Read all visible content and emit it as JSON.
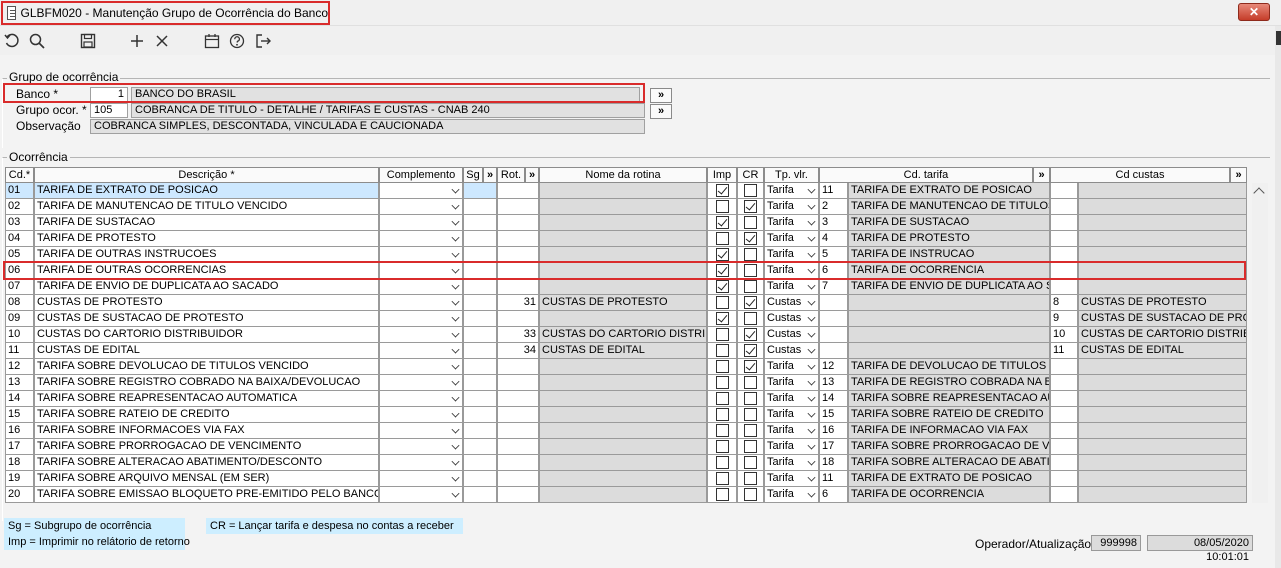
{
  "window": {
    "title": "GLBFM020 - Manutenção Grupo de Ocorrência do Banco",
    "close_label": "✕"
  },
  "group": {
    "title": "Grupo de ocorrência",
    "banco_label": "Banco *",
    "banco_code": "1",
    "banco_name": "BANCO DO BRASIL",
    "grupo_label": "Grupo ocor. *",
    "grupo_code": "105",
    "grupo_desc": "COBRANCA DE TITULO - DETALHE / TARIFAS E CUSTAS - CNAB 240",
    "obs_label": "Observação",
    "obs_value": "COBRANCA SIMPLES, DESCONTADA, VINCULADA E CAUCIONADA",
    "zoom_label": "»"
  },
  "ocorrencia": {
    "title": "Ocorrência",
    "headers": {
      "cd": "Cd.*",
      "descricao": "Descrição *",
      "complemento": "Complemento",
      "sg": "Sg",
      "zoom": "»",
      "rot": "Rot.",
      "nome_rotina": "Nome da rotina",
      "imp": "Imp",
      "cr": "CR",
      "tp_vlr": "Tp. vlr.",
      "cd_tarifa": "Cd. tarifa",
      "cd_custas": "Cd custas"
    },
    "rows": [
      {
        "cd": "01",
        "desc": "TARIFA DE EXTRATO DE POSICAO",
        "rot": "",
        "rot_name": "",
        "imp": true,
        "cr": false,
        "tp": "Tarifa",
        "tcode": "11",
        "tname": "TARIFA DE EXTRATO DE POSICAO",
        "ccode": "",
        "cname": ""
      },
      {
        "cd": "02",
        "desc": "TARIFA DE MANUTENCAO DE TITULO VENCIDO",
        "rot": "",
        "rot_name": "",
        "imp": false,
        "cr": true,
        "tp": "Tarifa",
        "tcode": "2",
        "tname": "TARIFA DE MANUTENCAO DE TITULOS VI",
        "ccode": "",
        "cname": ""
      },
      {
        "cd": "03",
        "desc": "TARIFA DE SUSTACAO",
        "rot": "",
        "rot_name": "",
        "imp": true,
        "cr": false,
        "tp": "Tarifa",
        "tcode": "3",
        "tname": "TARIFA DE SUSTACAO",
        "ccode": "",
        "cname": ""
      },
      {
        "cd": "04",
        "desc": "TARIFA DE PROTESTO",
        "rot": "",
        "rot_name": "",
        "imp": false,
        "cr": true,
        "tp": "Tarifa",
        "tcode": "4",
        "tname": "TARIFA DE PROTESTO",
        "ccode": "",
        "cname": ""
      },
      {
        "cd": "05",
        "desc": "TARIFA DE OUTRAS INSTRUCOES",
        "rot": "",
        "rot_name": "",
        "imp": true,
        "cr": false,
        "tp": "Tarifa",
        "tcode": "5",
        "tname": "TARIFA DE INSTRUCAO",
        "ccode": "",
        "cname": ""
      },
      {
        "cd": "06",
        "desc": "TARIFA DE OUTRAS OCORRENCIAS",
        "rot": "",
        "rot_name": "",
        "imp": true,
        "cr": false,
        "tp": "Tarifa",
        "tcode": "6",
        "tname": "TARIFA DE OCORRENCIA",
        "ccode": "",
        "cname": ""
      },
      {
        "cd": "07",
        "desc": "TARIFA DE ENVIO DE DUPLICATA AO SACADO",
        "rot": "",
        "rot_name": "",
        "imp": true,
        "cr": false,
        "tp": "Tarifa",
        "tcode": "7",
        "tname": "TARIFA DE ENVIO DE DUPLICATA AO SACAD",
        "ccode": "",
        "cname": ""
      },
      {
        "cd": "08",
        "desc": "CUSTAS DE PROTESTO",
        "rot": "31",
        "rot_name": "CUSTAS DE PROTESTO",
        "imp": false,
        "cr": true,
        "tp": "Custas",
        "tcode": "",
        "tname": "",
        "ccode": "8",
        "cname": "CUSTAS DE PROTESTO"
      },
      {
        "cd": "09",
        "desc": "CUSTAS DE SUSTACAO DE PROTESTO",
        "rot": "",
        "rot_name": "",
        "imp": true,
        "cr": false,
        "tp": "Custas",
        "tcode": "",
        "tname": "",
        "ccode": "9",
        "cname": "CUSTAS DE SUSTACAO DE PROT"
      },
      {
        "cd": "10",
        "desc": "CUSTAS DO CARTORIO DISTRIBUIDOR",
        "rot": "33",
        "rot_name": "CUSTAS DO CARTORIO DISTRIBU",
        "imp": false,
        "cr": true,
        "tp": "Custas",
        "tcode": "",
        "tname": "",
        "ccode": "10",
        "cname": "CUSTAS DE CARTORIO DISTRIBUI"
      },
      {
        "cd": "11",
        "desc": "CUSTAS DE EDITAL",
        "rot": "34",
        "rot_name": "CUSTAS DE EDITAL",
        "imp": false,
        "cr": true,
        "tp": "Custas",
        "tcode": "",
        "tname": "",
        "ccode": "11",
        "cname": "CUSTAS DE EDITAL"
      },
      {
        "cd": "12",
        "desc": "TARIFA SOBRE DEVOLUCAO DE TITULOS VENCIDO",
        "rot": "",
        "rot_name": "",
        "imp": false,
        "cr": true,
        "tp": "Tarifa",
        "tcode": "12",
        "tname": "TARIFA DE DEVOLUCAO DE TITULOS VEN",
        "ccode": "",
        "cname": ""
      },
      {
        "cd": "13",
        "desc": "TARIFA SOBRE REGISTRO COBRADO NA BAIXA/DEVOLUCAO",
        "rot": "",
        "rot_name": "",
        "imp": false,
        "cr": false,
        "tp": "Tarifa",
        "tcode": "13",
        "tname": "TARIFA DE REGISTRO COBRADA NA BAIX",
        "ccode": "",
        "cname": ""
      },
      {
        "cd": "14",
        "desc": "TARIFA SOBRE REAPRESENTACAO AUTOMATICA",
        "rot": "",
        "rot_name": "",
        "imp": false,
        "cr": false,
        "tp": "Tarifa",
        "tcode": "14",
        "tname": "TARIFA SOBRE REAPRESENTACAO AUTC",
        "ccode": "",
        "cname": ""
      },
      {
        "cd": "15",
        "desc": "TARIFA SOBRE RATEIO DE CREDITO",
        "rot": "",
        "rot_name": "",
        "imp": false,
        "cr": false,
        "tp": "Tarifa",
        "tcode": "15",
        "tname": "TARIFA SOBRE RATEIO DE CREDITO",
        "ccode": "",
        "cname": ""
      },
      {
        "cd": "16",
        "desc": "TARIFA SOBRE INFORMACOES VIA FAX",
        "rot": "",
        "rot_name": "",
        "imp": false,
        "cr": false,
        "tp": "Tarifa",
        "tcode": "16",
        "tname": "TARIFA DE INFORMACAO VIA FAX",
        "ccode": "",
        "cname": ""
      },
      {
        "cd": "17",
        "desc": "TARIFA SOBRE PRORROGACAO DE VENCIMENTO",
        "rot": "",
        "rot_name": "",
        "imp": false,
        "cr": false,
        "tp": "Tarifa",
        "tcode": "17",
        "tname": "TARIFA SOBRE PRORROGACAO DE VENC",
        "ccode": "",
        "cname": ""
      },
      {
        "cd": "18",
        "desc": "TARIFA SOBRE ALTERACAO ABATIMENTO/DESCONTO",
        "rot": "",
        "rot_name": "",
        "imp": false,
        "cr": false,
        "tp": "Tarifa",
        "tcode": "18",
        "tname": "TARIFA SOBRE ALTERACAO DE ABATIME",
        "ccode": "",
        "cname": ""
      },
      {
        "cd": "19",
        "desc": "TARIFA SOBRE ARQUIVO MENSAL (EM SER)",
        "rot": "",
        "rot_name": "",
        "imp": false,
        "cr": false,
        "tp": "Tarifa",
        "tcode": "11",
        "tname": "TARIFA DE EXTRATO DE POSICAO",
        "ccode": "",
        "cname": ""
      },
      {
        "cd": "20",
        "desc": "TARIFA SOBRE EMISSAO BLOQUETO PRE-EMITIDO PELO BANCO",
        "rot": "",
        "rot_name": "",
        "imp": false,
        "cr": false,
        "tp": "Tarifa",
        "tcode": "6",
        "tname": "TARIFA DE OCORRENCIA",
        "ccode": "",
        "cname": ""
      }
    ]
  },
  "legend": {
    "sg": "Sg = Subgrupo de ocorrência",
    "imp": "Imp = Imprimir no relátorio de retorno",
    "cr": "CR = Lançar tarifa e despesa no contas a receber"
  },
  "footer": {
    "operator_label": "Operador/Atualização",
    "operator": "999998",
    "updated": "08/05/2020 10:01:01"
  },
  "colors": {
    "highlight": "#d92b2b",
    "selected_row": "#cde8ff",
    "legend_bg": "#cdeeff"
  }
}
